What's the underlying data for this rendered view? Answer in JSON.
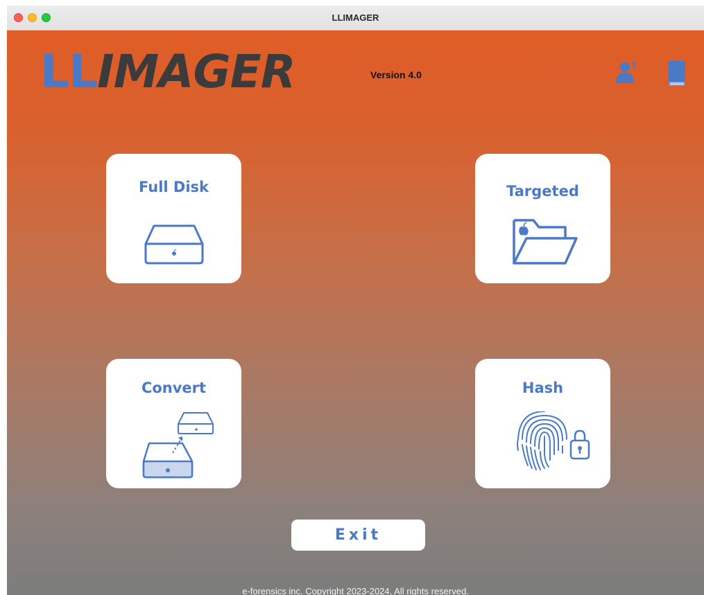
{
  "window": {
    "title": "LLIMAGER"
  },
  "header": {
    "logo_ll": "LL",
    "logo_imager": "IMAGER",
    "version": "Version 4.0",
    "help_icon": "user-help-icon",
    "manual_icon": "book-icon"
  },
  "cards": {
    "full_disk": {
      "label": "Full Disk",
      "icon": "disk-drive-icon"
    },
    "targeted": {
      "label": "Targeted",
      "icon": "open-folder-icon"
    },
    "convert": {
      "label": "Convert",
      "icon": "convert-drives-icon"
    },
    "hash": {
      "label": "Hash",
      "icon": "fingerprint-lock-icon"
    }
  },
  "footer": {
    "exit_label": "Exit",
    "copyright": "e-forensics inc. Copyright 2023-2024. All rights reserved."
  },
  "colors": {
    "accent": "#4a79c8",
    "background_top": "#e05d27",
    "background_bottom": "#7d7d7d"
  }
}
